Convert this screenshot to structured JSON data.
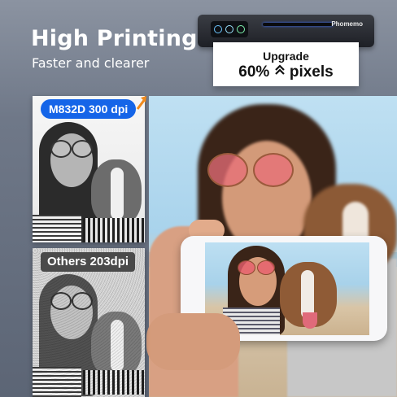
{
  "headline": {
    "title": "High Printing",
    "subtitle": "Faster and clearer"
  },
  "printer": {
    "brand": "Phomemo"
  },
  "paper": {
    "upgrade": "Upgrade",
    "value": "60%",
    "unit": "pixels"
  },
  "comparison": {
    "top_label": "M832D 300 dpi",
    "bottom_label": "Others 203dpi"
  },
  "colors": {
    "badge_primary": "#1565e8",
    "badge_secondary": "#4a4a4a",
    "arrow_accent": "#f08a1c",
    "background": "#6f7888"
  },
  "icons": {
    "upgrade_arrow": "chevron-up-stack-icon",
    "badge_arrow": "trend-up-arrow-icon"
  }
}
